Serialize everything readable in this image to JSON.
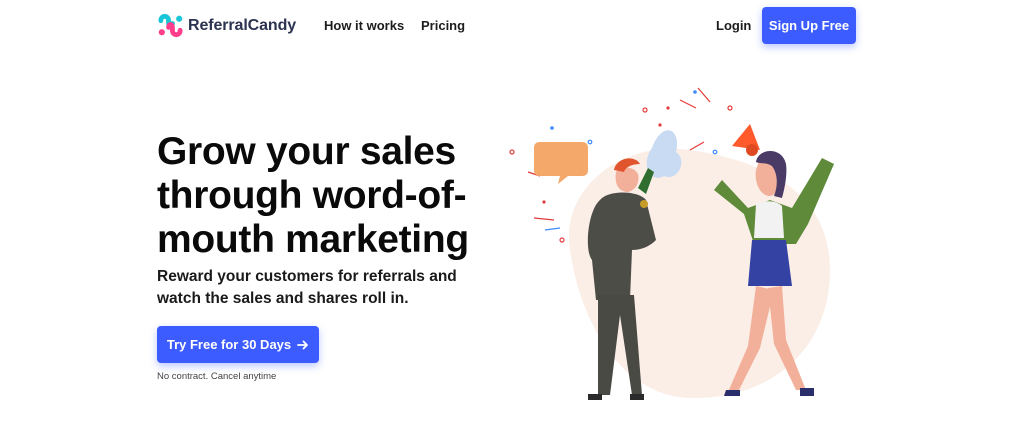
{
  "brand": {
    "name": "ReferralCandy"
  },
  "nav": {
    "links": [
      {
        "label": "How it works"
      },
      {
        "label": "Pricing"
      }
    ],
    "login_label": "Login",
    "signup_label": "Sign Up Free"
  },
  "hero": {
    "title": "Grow your sales through word-of-mouth marketing",
    "subtitle": "Reward your customers for referrals and watch the sales and shares roll in.",
    "cta_label": "Try Free for 30 Days",
    "cta_icon": "arrow-right-icon",
    "note": "No contract. Cancel anytime"
  },
  "illustration": {
    "subject": "people-celebrating-referral"
  },
  "colors": {
    "accent": "#3d5cff",
    "logo_pink": "#ff3d8b",
    "logo_cyan": "#19c6d8",
    "megaphone": "#ff5a2c",
    "jacket_green": "#5e8a3a"
  }
}
